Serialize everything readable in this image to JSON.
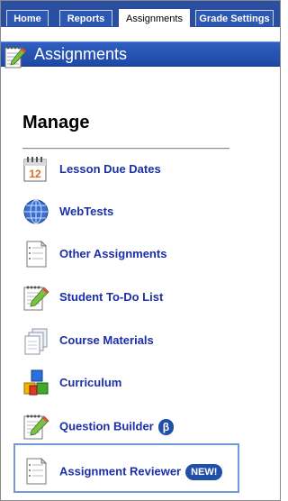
{
  "tabs": [
    {
      "label": "Home"
    },
    {
      "label": "Reports"
    },
    {
      "label": "Assignments",
      "active": true
    },
    {
      "label": "Grade Settings"
    }
  ],
  "header": {
    "title": "Assignments",
    "icon": "notepad-pencil-icon"
  },
  "section": {
    "heading": "Manage"
  },
  "items": [
    {
      "label": "Lesson Due Dates",
      "icon": "calendar-icon"
    },
    {
      "label": "WebTests",
      "icon": "globe-icon"
    },
    {
      "label": "Other Assignments",
      "icon": "document-icon"
    },
    {
      "label": "Student To-Do List",
      "icon": "notepad-pencil-icon"
    },
    {
      "label": "Course Materials",
      "icon": "stacked-pages-icon"
    },
    {
      "label": "Curriculum",
      "icon": "blocks-icon"
    },
    {
      "label": "Question Builder",
      "icon": "notepad-pencil-icon",
      "badge": "β"
    },
    {
      "label": "Assignment Reviewer",
      "icon": "document-icon",
      "badge": "NEW!",
      "highlighted": true
    }
  ],
  "colors": {
    "brand": "#2a4fa1",
    "link": "#1a2fa8",
    "badge": "#1f4fa8",
    "highlight_border": "#6f9ad6"
  }
}
